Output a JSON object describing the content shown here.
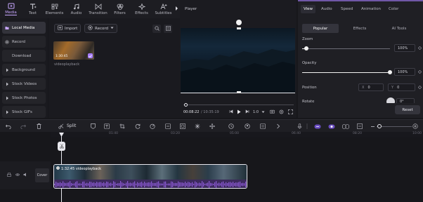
{
  "toolbar": {
    "items": [
      {
        "label": "Media",
        "icon": "media-icon"
      },
      {
        "label": "Text",
        "icon": "text-icon"
      },
      {
        "label": "Elements",
        "icon": "elements-icon"
      },
      {
        "label": "Audio",
        "icon": "audio-icon"
      },
      {
        "label": "Transition",
        "icon": "transition-icon"
      },
      {
        "label": "Filters",
        "icon": "filters-icon"
      },
      {
        "label": "Effects",
        "icon": "effects-icon"
      },
      {
        "label": "Subtitles",
        "icon": "subtitles-icon"
      }
    ],
    "active_index": 0,
    "accent_color": "#c7a6ff"
  },
  "sidebar": {
    "items": [
      {
        "label": "Local Media"
      },
      {
        "label": "Record"
      },
      {
        "label": "Download"
      },
      {
        "label": "Background"
      },
      {
        "label": "Stock Videos"
      },
      {
        "label": "Stock Photos"
      },
      {
        "label": "Stock GIFs"
      }
    ],
    "active_index": 0
  },
  "media": {
    "import_label": "Import",
    "record_label": "Record",
    "thumb_duration": "1:30:45",
    "thumb_name": "videoplayback"
  },
  "player": {
    "title": "Player",
    "current_time": "00:08:22",
    "total_time": "/ 10:35:19",
    "zoom": "1:0",
    "progress_fraction": 0.02
  },
  "props": {
    "tabs": [
      "View",
      "Audio",
      "Speed",
      "Animation",
      "Color"
    ],
    "active_tab": 0,
    "subtabs": [
      "Popular",
      "Effects",
      "AI Tools"
    ],
    "active_subtab": 0,
    "zoom_label": "Zoom",
    "zoom_value": "100%",
    "zoom_fraction": 0.05,
    "opacity_label": "Opacity",
    "opacity_value": "100%",
    "opacity_fraction": 1.0,
    "position_label": "Position",
    "pos_x_label": "X",
    "pos_x_value": "0",
    "pos_y_label": "Y",
    "pos_y_value": "0",
    "rotate_label": "Rotate",
    "rotate_value": "0°",
    "reset_label": "Reset"
  },
  "timeline": {
    "split_label": "Split",
    "ruler_ticks": [
      "01:40",
      "03:20",
      "05:00",
      "06:40",
      "08:20",
      "10:00",
      "11:40",
      "13:20"
    ],
    "cover_label": "Cover",
    "clip_label": "1:32:45 videoplayback",
    "waveform_color": "#8d5ad6"
  }
}
